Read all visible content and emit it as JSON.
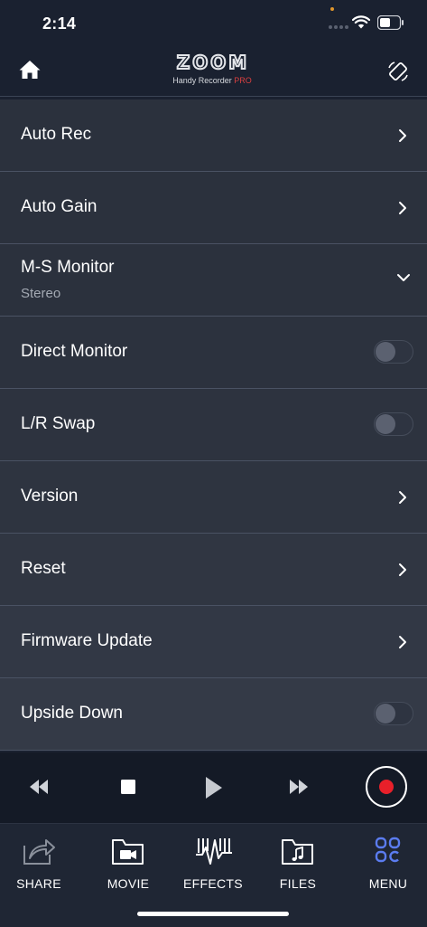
{
  "status_bar": {
    "time": "2:14"
  },
  "header": {
    "logo_text": "ZOOM",
    "logo_subtitle": "Handy Recorder",
    "logo_subtitle_pro": "PRO"
  },
  "settings": [
    {
      "label": "Auto Rec",
      "control": "chevron-right"
    },
    {
      "label": "Auto Gain",
      "control": "chevron-right"
    },
    {
      "label": "M-S Monitor",
      "sub": "Stereo",
      "control": "chevron-down"
    },
    {
      "label": "Direct Monitor",
      "control": "toggle",
      "on": false
    },
    {
      "label": "L/R Swap",
      "control": "toggle",
      "on": false
    },
    {
      "label": "Version",
      "control": "chevron-right"
    },
    {
      "label": "Reset",
      "control": "chevron-right"
    },
    {
      "label": "Firmware Update",
      "control": "chevron-right"
    },
    {
      "label": "Upside Down",
      "control": "toggle",
      "on": false
    }
  ],
  "transport": {
    "icons": [
      "rewind-icon",
      "stop-icon",
      "play-icon",
      "fast-forward-icon",
      "record-icon"
    ],
    "record_color": "#e8202a"
  },
  "tabs": [
    {
      "label": "SHARE",
      "icon": "share-icon",
      "active": false
    },
    {
      "label": "MOVIE",
      "icon": "movie-folder-icon",
      "active": false
    },
    {
      "label": "EFFECTS",
      "icon": "effects-icon",
      "active": false
    },
    {
      "label": "FILES",
      "icon": "files-folder-icon",
      "active": false
    },
    {
      "label": "MENU",
      "icon": "menu-grid-icon",
      "active": true
    }
  ],
  "colors": {
    "accent": "#5b7cf0",
    "background": "#1a2130",
    "row_bg": "#2a303c"
  }
}
